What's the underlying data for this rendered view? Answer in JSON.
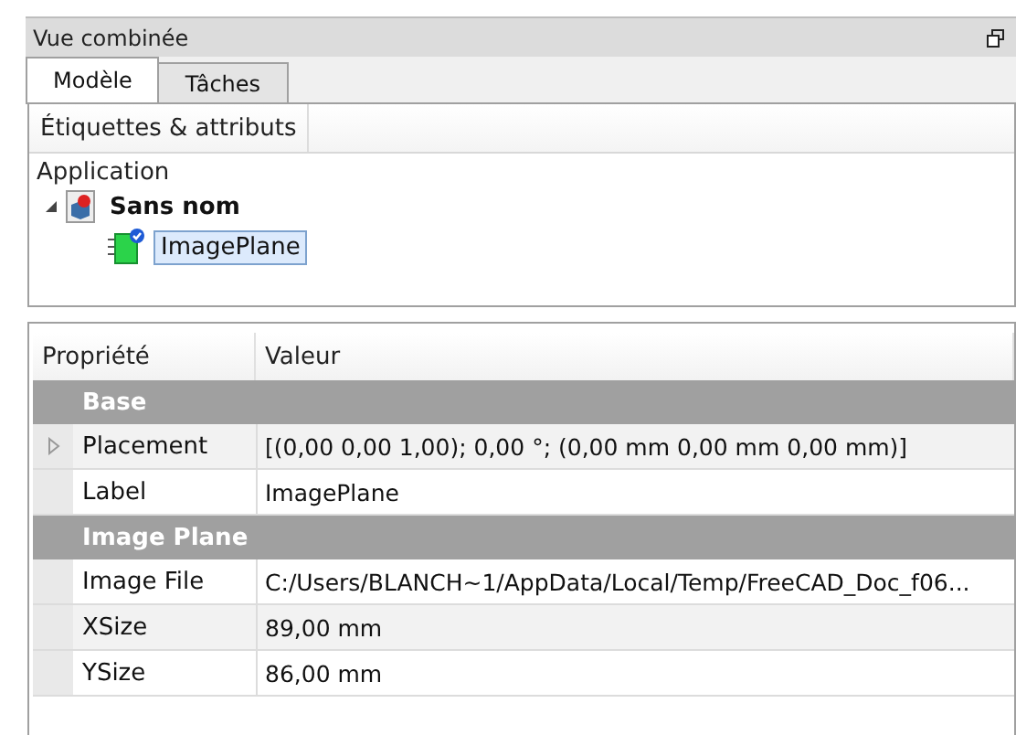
{
  "panel": {
    "title": "Vue combinée"
  },
  "tabs": [
    {
      "label": "Modèle",
      "selected": true
    },
    {
      "label": "Tâches",
      "selected": false
    }
  ],
  "tree": {
    "header": "Étiquettes & attributs",
    "root": "Application",
    "items": [
      {
        "label": "Sans nom",
        "kind": "document",
        "expanded": true,
        "selected": false,
        "children": [
          {
            "label": "ImagePlane",
            "kind": "image",
            "selected": true
          }
        ]
      }
    ]
  },
  "properties": {
    "columns": [
      "Propriété",
      "Valeur"
    ],
    "rows": [
      {
        "kind": "group",
        "name": "Base"
      },
      {
        "kind": "property",
        "name": "Placement",
        "value": "[(0,00 0,00 1,00); 0,00 °; (0,00 mm  0,00 mm  0,00 mm)]",
        "expandable": true,
        "shaded": true
      },
      {
        "kind": "property",
        "name": "Label",
        "value": "ImagePlane",
        "expandable": false,
        "shaded": false
      },
      {
        "kind": "group",
        "name": "Image Plane"
      },
      {
        "kind": "property",
        "name": "Image File",
        "value": "C:/Users/BLANCH~1/AppData/Local/Temp/FreeCAD_Doc_f06...",
        "expandable": false,
        "shaded": false
      },
      {
        "kind": "property",
        "name": "XSize",
        "value": "89,00 mm",
        "expandable": false,
        "shaded": true
      },
      {
        "kind": "property",
        "name": "YSize",
        "value": "86,00 mm",
        "expandable": false,
        "shaded": false
      }
    ]
  }
}
